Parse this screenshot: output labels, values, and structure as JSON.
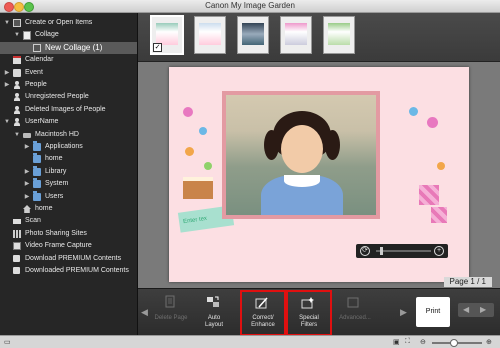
{
  "window": {
    "title": "Canon My Image Garden"
  },
  "sidebar": {
    "items": [
      {
        "label": "Create or Open Items",
        "indent": 0,
        "icon": "collage-icon",
        "expanded": true
      },
      {
        "label": "Collage",
        "indent": 1,
        "icon": "doc-icon",
        "expanded": true
      },
      {
        "label": "New Collage (1)",
        "indent": 2,
        "icon": "collage-icon",
        "selected": true
      },
      {
        "label": "Calendar",
        "indent": 0,
        "icon": "calendar-icon"
      },
      {
        "label": "Event",
        "indent": 0,
        "icon": "event-icon",
        "collapsed": true
      },
      {
        "label": "People",
        "indent": 0,
        "icon": "person-icon",
        "collapsed": true
      },
      {
        "label": "Unregistered People",
        "indent": 0,
        "icon": "person-icon"
      },
      {
        "label": "Deleted Images of People",
        "indent": 0,
        "icon": "person-icon"
      },
      {
        "label": "UserName",
        "indent": 0,
        "icon": "person-icon",
        "expanded": true
      },
      {
        "label": "Macintosh HD",
        "indent": 1,
        "icon": "hdd-icon",
        "expanded": true
      },
      {
        "label": "Applications",
        "indent": 2,
        "icon": "folder-icon",
        "collapsed": true
      },
      {
        "label": "home",
        "indent": 2,
        "icon": "folder-icon"
      },
      {
        "label": "Library",
        "indent": 2,
        "icon": "folder-icon",
        "collapsed": true
      },
      {
        "label": "System",
        "indent": 2,
        "icon": "folder-icon",
        "collapsed": true
      },
      {
        "label": "Users",
        "indent": 2,
        "icon": "folder-icon",
        "collapsed": true
      },
      {
        "label": "home",
        "indent": 1,
        "icon": "house-icon"
      },
      {
        "label": "Scan",
        "indent": 0,
        "icon": "scan-icon"
      },
      {
        "label": "Photo Sharing Sites",
        "indent": 0,
        "icon": "grid-icon"
      },
      {
        "label": "Video Frame Capture",
        "indent": 0,
        "icon": "film-icon"
      },
      {
        "label": "Download PREMIUM Contents",
        "indent": 0,
        "icon": "download-icon"
      },
      {
        "label": "Downloaded PREMIUM Contents",
        "indent": 0,
        "icon": "download-icon"
      }
    ]
  },
  "thumbnails": {
    "count": 5,
    "selected_index": 0
  },
  "canvas": {
    "text_placeholder": "Enter tex",
    "page_label": "Page 1 / 1"
  },
  "toolbar": {
    "buttons": [
      {
        "label": "Delete Page",
        "enabled": false,
        "icon": "delete-page-icon"
      },
      {
        "label": "Auto\nLayout",
        "enabled": true,
        "icon": "auto-layout-icon"
      },
      {
        "label": "Correct/\nEnhance",
        "enabled": true,
        "icon": "correct-enhance-icon",
        "highlighted": true
      },
      {
        "label": "Special\nFilters",
        "enabled": true,
        "icon": "special-filters-icon",
        "highlighted": true
      },
      {
        "label": "Advanced...",
        "enabled": false,
        "icon": "advanced-icon"
      }
    ],
    "print_label": "Print"
  },
  "colors": {
    "highlight": "#e01010",
    "collage_bg": "#fcdfe3",
    "frame": "#e39aa2",
    "sidebar_bg": "#262626"
  }
}
